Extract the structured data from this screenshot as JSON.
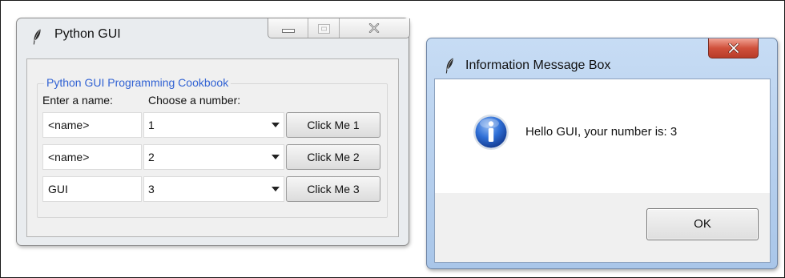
{
  "main_window": {
    "title": "Python GUI",
    "icon": "feather-icon",
    "labelframe_title": "Python GUI Programming Cookbook",
    "name_label": "Enter a name:",
    "number_label": "Choose a number:",
    "rows": [
      {
        "name": "<name>",
        "number": "1",
        "button": "Click Me 1"
      },
      {
        "name": "<name>",
        "number": "2",
        "button": "Click Me 2"
      },
      {
        "name": "GUI",
        "number": "3",
        "button": "Click Me 3"
      }
    ]
  },
  "message_box": {
    "title": "Information Message Box",
    "icon": "feather-icon",
    "message_icon": "info-icon",
    "message": "Hello GUI, your number is: 3",
    "ok_label": "OK"
  },
  "colors": {
    "labelframe_title": "#3162d3",
    "close_button": "#c74430",
    "info_icon": "#1f5cc4"
  }
}
